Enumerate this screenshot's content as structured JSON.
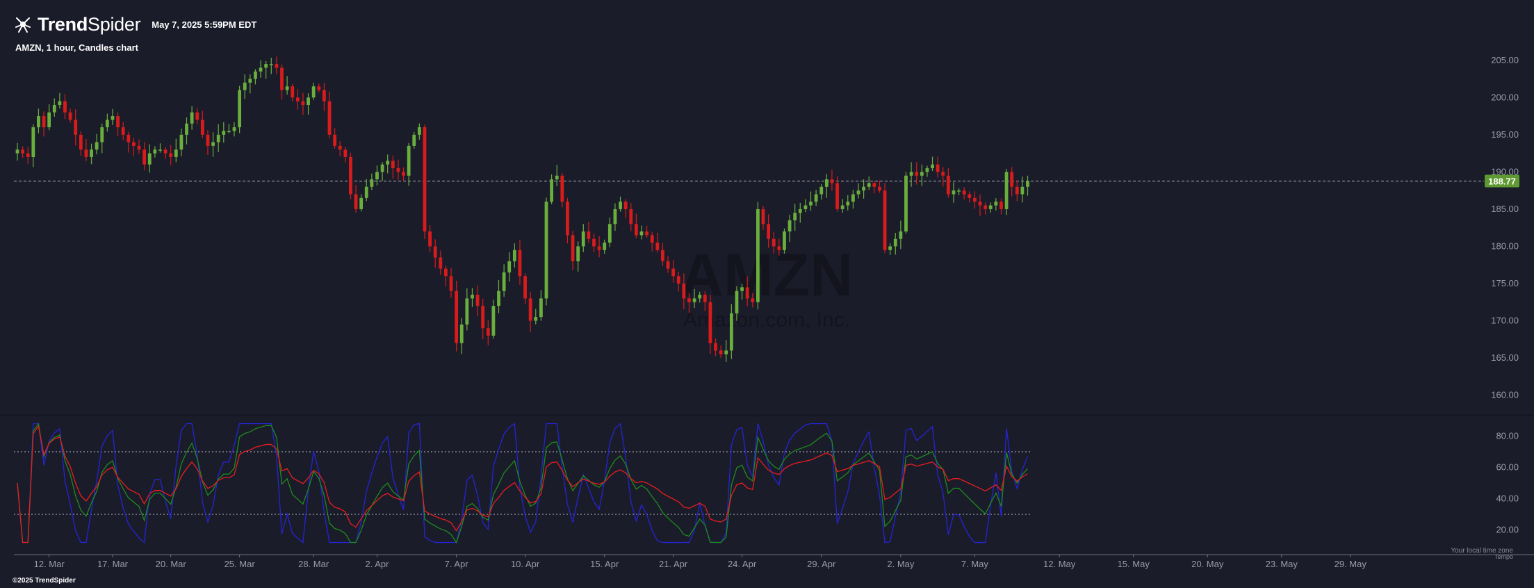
{
  "header": {
    "logo_bold": "Trend",
    "logo_light": "Spider",
    "date": "May 7, 2025 5:59PM EDT"
  },
  "chart_title": "AMZN, 1 hour, Candles chart",
  "footer": {
    "copyright": "©2025 TrendSpider",
    "timezone": "Your local time zone",
    "timezone_sub": "Tempo"
  },
  "watermark": {
    "symbol": "AMZN",
    "name": "Amazon.com, Inc."
  },
  "colors": {
    "background": "#1b1c2a",
    "up": "#6aaf3d",
    "down": "#d81b1b",
    "price_tag": "#5e9a31",
    "ind_blue": "#2424d6",
    "ind_green": "#1c8c1c",
    "ind_red": "#e61e1e"
  },
  "chart_data": [
    {
      "type": "candlestick",
      "symbol": "AMZN",
      "interval": "1 hour",
      "ylim": [
        158,
        207.5
      ],
      "y_ticks": [
        160,
        165,
        170,
        175,
        180,
        185,
        190,
        195,
        200,
        205
      ],
      "y_tick_labels": [
        "160.00",
        "165.00",
        "170.00",
        "175.00",
        "180.00",
        "185.00",
        "190.00",
        "195.00",
        "200.00",
        "205.00"
      ],
      "current_price": 188.77,
      "current_price_label": "188.77",
      "closes": [
        193,
        192.5,
        192,
        196,
        197.5,
        196,
        198,
        199,
        199.5,
        198,
        197,
        195,
        193,
        192,
        193,
        194,
        196,
        197,
        197.5,
        196,
        195,
        194,
        193.5,
        193,
        191,
        192.5,
        193,
        193,
        192.5,
        192,
        193,
        195,
        196.5,
        198,
        197,
        195,
        193.5,
        194,
        195,
        195.5,
        195.5,
        196,
        201,
        202,
        202.5,
        203.5,
        204,
        204.5,
        204.5,
        204,
        201,
        201.5,
        200,
        199.5,
        199,
        200,
        201.5,
        201,
        199.5,
        195,
        193.5,
        193,
        192,
        187,
        185,
        186.5,
        188,
        189,
        190,
        191,
        191.5,
        190.5,
        190,
        189.5,
        193.5,
        195,
        196,
        182,
        180,
        178.5,
        177,
        176,
        174,
        167,
        169.5,
        173,
        173.5,
        172,
        169,
        168,
        172,
        174,
        176.5,
        178,
        179.5,
        176,
        173,
        170,
        170.5,
        173,
        186,
        189,
        189.5,
        186,
        181.5,
        178,
        180,
        182,
        181,
        180,
        179.5,
        180.5,
        183,
        185,
        186,
        185,
        183,
        181.5,
        182,
        181.5,
        180.5,
        179.5,
        178,
        177,
        176,
        175,
        173,
        172.5,
        173,
        173.5,
        172.5,
        167,
        166,
        165.5,
        166,
        171,
        174,
        174.5,
        173,
        172.5,
        185,
        183,
        181,
        180,
        179.5,
        182,
        183.5,
        184.5,
        185,
        185.5,
        186,
        187,
        188,
        189,
        188.5,
        185,
        185.5,
        186,
        187,
        187.5,
        188,
        188.5,
        188,
        187.5,
        179.5,
        180,
        181,
        182,
        189.5,
        190,
        189.5,
        190,
        190.5,
        191,
        190,
        189.5,
        187,
        187.5,
        187.5,
        187,
        186.5,
        186,
        185.5,
        185,
        185.5,
        186,
        185,
        190,
        188,
        187,
        188,
        188.77
      ],
      "indicator": {
        "name": "oscillator",
        "ylim": [
          10,
          90
        ],
        "y_ticks": [
          20,
          40,
          60,
          80
        ],
        "y_tick_labels": [
          "20.00",
          "40.00",
          "60.00",
          "80.00"
        ],
        "upper_band": 70,
        "lower_band": 30,
        "series": [
          {
            "color": "blue"
          },
          {
            "color": "green"
          },
          {
            "color": "red"
          }
        ]
      },
      "x_labels": [
        {
          "label": "12. Mar",
          "index": 6
        },
        {
          "label": "17. Mar",
          "index": 18
        },
        {
          "label": "20. Mar",
          "index": 29
        },
        {
          "label": "25. Mar",
          "index": 42
        },
        {
          "label": "28. Mar",
          "index": 56
        },
        {
          "label": "2. Apr",
          "index": 68
        },
        {
          "label": "7. Apr",
          "index": 83
        },
        {
          "label": "10. Apr",
          "index": 96
        },
        {
          "label": "15. Apr",
          "index": 111
        },
        {
          "label": "21. Apr",
          "index": 124
        },
        {
          "label": "24. Apr",
          "index": 137
        },
        {
          "label": "29. Apr",
          "index": 152
        },
        {
          "label": "2. May",
          "index": 167
        },
        {
          "label": "7. May",
          "index": 181
        },
        {
          "label": "12. May",
          "index": 197
        },
        {
          "label": "15. May",
          "index": 211
        },
        {
          "label": "20. May",
          "index": 225
        },
        {
          "label": "23. May",
          "index": 239
        },
        {
          "label": "29. May",
          "index": 252
        }
      ]
    }
  ]
}
